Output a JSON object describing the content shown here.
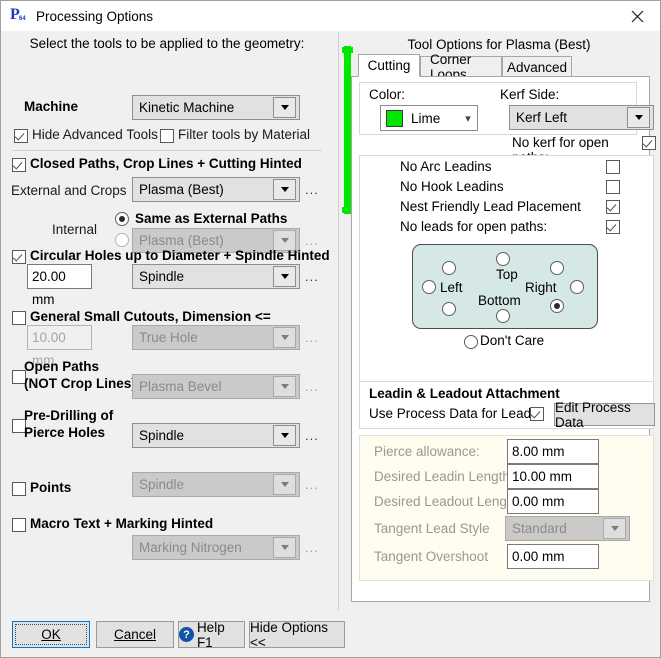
{
  "window": {
    "title": "Processing Options",
    "icon": "app-p64-icon",
    "close_icon": "close-icon"
  },
  "left": {
    "header": "Select the tools to be applied to the geometry:",
    "machine_label": "Machine",
    "machine_value": "Kinetic Machine",
    "hide_advanced": {
      "label": "Hide Advanced Tools",
      "checked": true
    },
    "filter_by_material": {
      "label": "Filter tools by Material",
      "checked": false
    },
    "closed_paths": {
      "label": "Closed Paths,  Crop Lines  +  Cutting Hinted",
      "checked": true
    },
    "external_crops_label": "External and Crops",
    "external_crops_value": "Plasma (Best)",
    "internal_label": "Internal",
    "internal_same_label": "Same as External Paths",
    "internal_same_selected": true,
    "internal_other_selected": false,
    "internal_value": "Plasma (Best)",
    "circular_holes": {
      "label": "Circular Holes up to Diameter   +  Spindle Hinted",
      "checked": true
    },
    "circular_diameter": "20.00 mm",
    "circular_tool": "Spindle",
    "general_cutouts": {
      "label": "General Small Cutouts, Dimension <=",
      "checked": false
    },
    "general_dimension": "10.00 mm",
    "general_tool": "True Hole",
    "open_paths": {
      "label_line1": "Open Paths",
      "label_line2": "(NOT Crop Lines)",
      "checked": false
    },
    "open_paths_tool": "Plasma Bevel",
    "pre_drilling": {
      "label_line1": "Pre-Drilling of",
      "label_line2": "Pierce Holes",
      "checked": false
    },
    "pre_drilling_tool": "Spindle",
    "points": {
      "label": "Points",
      "checked": false
    },
    "points_tool": "Spindle",
    "macro_text": {
      "label": "Macro Text  +  Marking Hinted",
      "checked": false
    },
    "macro_text_tool": "Marking Nitrogen",
    "ellipsis": "..."
  },
  "right": {
    "title": "Tool Options for Plasma (Best)",
    "tabs": [
      {
        "label": "Cutting",
        "active": true
      },
      {
        "label": "Corner Loops",
        "active": false
      },
      {
        "label": "Advanced",
        "active": false
      }
    ],
    "color_label": "Color:",
    "color_value": "Lime",
    "color_hex": "#00e700",
    "kerf_label": "Kerf Side:",
    "kerf_value": "Kerf Left",
    "no_kerf_open_paths": {
      "label": "No kerf for open paths:",
      "checked": true
    },
    "options": [
      {
        "label": "No Arc Leadins",
        "checked": false
      },
      {
        "label": "No Hook Leadins",
        "checked": false
      },
      {
        "label": "Nest Friendly Lead Placement",
        "checked": true
      },
      {
        "label": "No leads for open paths:",
        "checked": true
      }
    ],
    "placement": {
      "top_label": "Top",
      "left_label": "Left",
      "right_label": "Right",
      "bottom_label": "Bottom",
      "selected_index": 8,
      "dont_care": {
        "label": "Don't Care",
        "selected": false
      }
    },
    "leadin_group_title": "Leadin & Leadout Attachment",
    "use_process_data": {
      "label": "Use Process Data for Leads",
      "checked": true
    },
    "edit_process_data_button": "Edit Process Data",
    "fields": [
      {
        "label": "Pierce allowance:",
        "value": "8.00 mm"
      },
      {
        "label": "Desired Leadin Length:",
        "value": "10.00 mm"
      },
      {
        "label": "Desired Leadout Length:",
        "value": "0.00 mm"
      }
    ],
    "tangent_style_label": "Tangent Lead Style",
    "tangent_style_value": "Standard",
    "tangent_overshoot_label": "Tangent Overshoot",
    "tangent_overshoot_value": "0.00 mm"
  },
  "footer": {
    "ok": "OK",
    "cancel": "Cancel",
    "help": "Help F1",
    "help_icon": "question-mark-icon",
    "hide_options": "Hide Options <<"
  }
}
